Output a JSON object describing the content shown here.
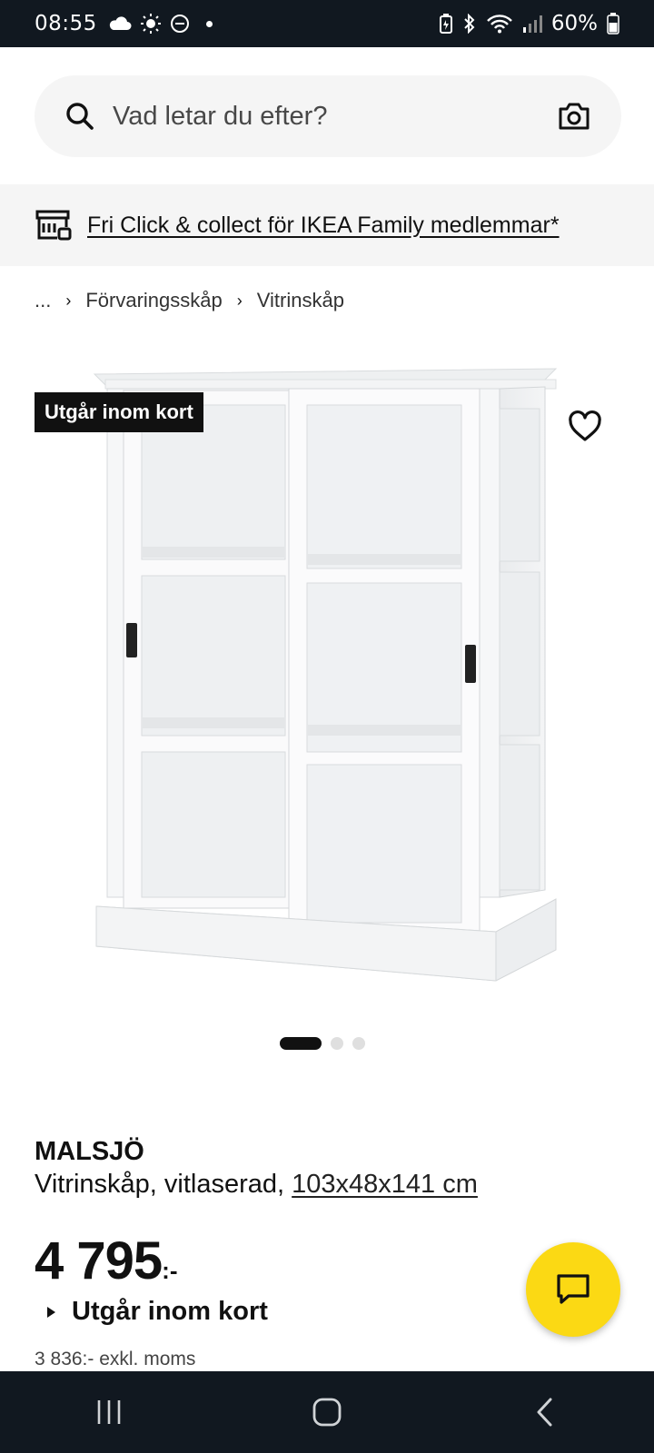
{
  "status_bar": {
    "time": "08:55",
    "battery": "60%",
    "left_icons": [
      "cloud-icon",
      "sun-icon",
      "do-not-disturb-icon"
    ],
    "right_icons": [
      "battery-saver-icon",
      "bluetooth-icon",
      "wifi-icon",
      "signal-icon",
      "battery-icon"
    ]
  },
  "search": {
    "placeholder": "Vad letar du efter?",
    "icon": "search-icon",
    "camera_icon": "camera-icon"
  },
  "banner": {
    "text": "Fri Click & collect för IKEA Family medlemmar*",
    "icon": "store-pickup-icon"
  },
  "breadcrumb": {
    "items": [
      "...",
      "Förvaringsskåp",
      "Vitrinskåp"
    ]
  },
  "product": {
    "badge": "Utgår inom kort",
    "brand": "MALSJÖ",
    "description": "Vitrinskåp, vitlaserad,",
    "dimensions": "103x48x141 cm",
    "price": "4 795",
    "price_suffix": ":-",
    "availability": "Utgår inom kort",
    "price_excl_vat": "3 836:- exkl. moms"
  },
  "carousel": {
    "count": 3,
    "active_index": 0
  },
  "colors": {
    "status_bar_bg": "#111820",
    "fab_yellow": "#fbd914",
    "light_gray": "#f5f5f5"
  }
}
